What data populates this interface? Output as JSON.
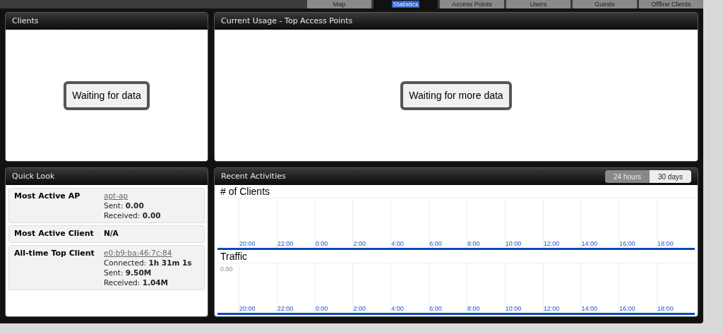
{
  "tabs": [
    {
      "label": "Map",
      "selected": false
    },
    {
      "label": "Statistics",
      "selected": true
    },
    {
      "label": "Access Points",
      "selected": false
    },
    {
      "label": "Users",
      "selected": false
    },
    {
      "label": "Guests",
      "selected": false
    },
    {
      "label": "Offline Clients",
      "selected": false
    }
  ],
  "clients": {
    "title": "Clients",
    "status": "Waiting for data"
  },
  "usage": {
    "title": "Current Usage - Top Access Points",
    "status": "Waiting for more data"
  },
  "quick_look": {
    "title": "Quick Look",
    "rows": [
      {
        "label": "Most Active AP",
        "value": "apt-ap",
        "linked": true,
        "details": [
          {
            "label": "Sent:",
            "value": "0.00"
          },
          {
            "label": "Received:",
            "value": "0.00"
          }
        ]
      },
      {
        "label": "Most Active Client",
        "value": "N/A",
        "linked": false,
        "details": []
      },
      {
        "label": "All-time Top Client",
        "value": "e0:b9:ba:46:7c:84",
        "linked": true,
        "details": [
          {
            "label": "Connected:",
            "value": "1h 31m 1s"
          },
          {
            "label": "Sent:",
            "value": "9.50M"
          },
          {
            "label": "Received:",
            "value": "1.04M"
          }
        ]
      }
    ]
  },
  "recent": {
    "title": "Recent Activities",
    "ranges": [
      {
        "label": "24 hours",
        "selected": true
      },
      {
        "label": "30 days",
        "selected": false
      }
    ],
    "charts": [
      {
        "title": "# of Clients",
        "x_labels": [
          "20:00",
          "22:00",
          "0:00",
          "2:00",
          "4:00",
          "6:00",
          "8:00",
          "10:00",
          "12:00",
          "14:00",
          "16:00",
          "18:00"
        ]
      },
      {
        "title": "Traffic",
        "y_tick": "0.00",
        "x_labels": [
          "20:00",
          "22:00",
          "0:00",
          "2:00",
          "4:00",
          "6:00",
          "8:00",
          "10:00",
          "12:00",
          "14:00",
          "16:00",
          "18:00"
        ]
      }
    ]
  }
}
